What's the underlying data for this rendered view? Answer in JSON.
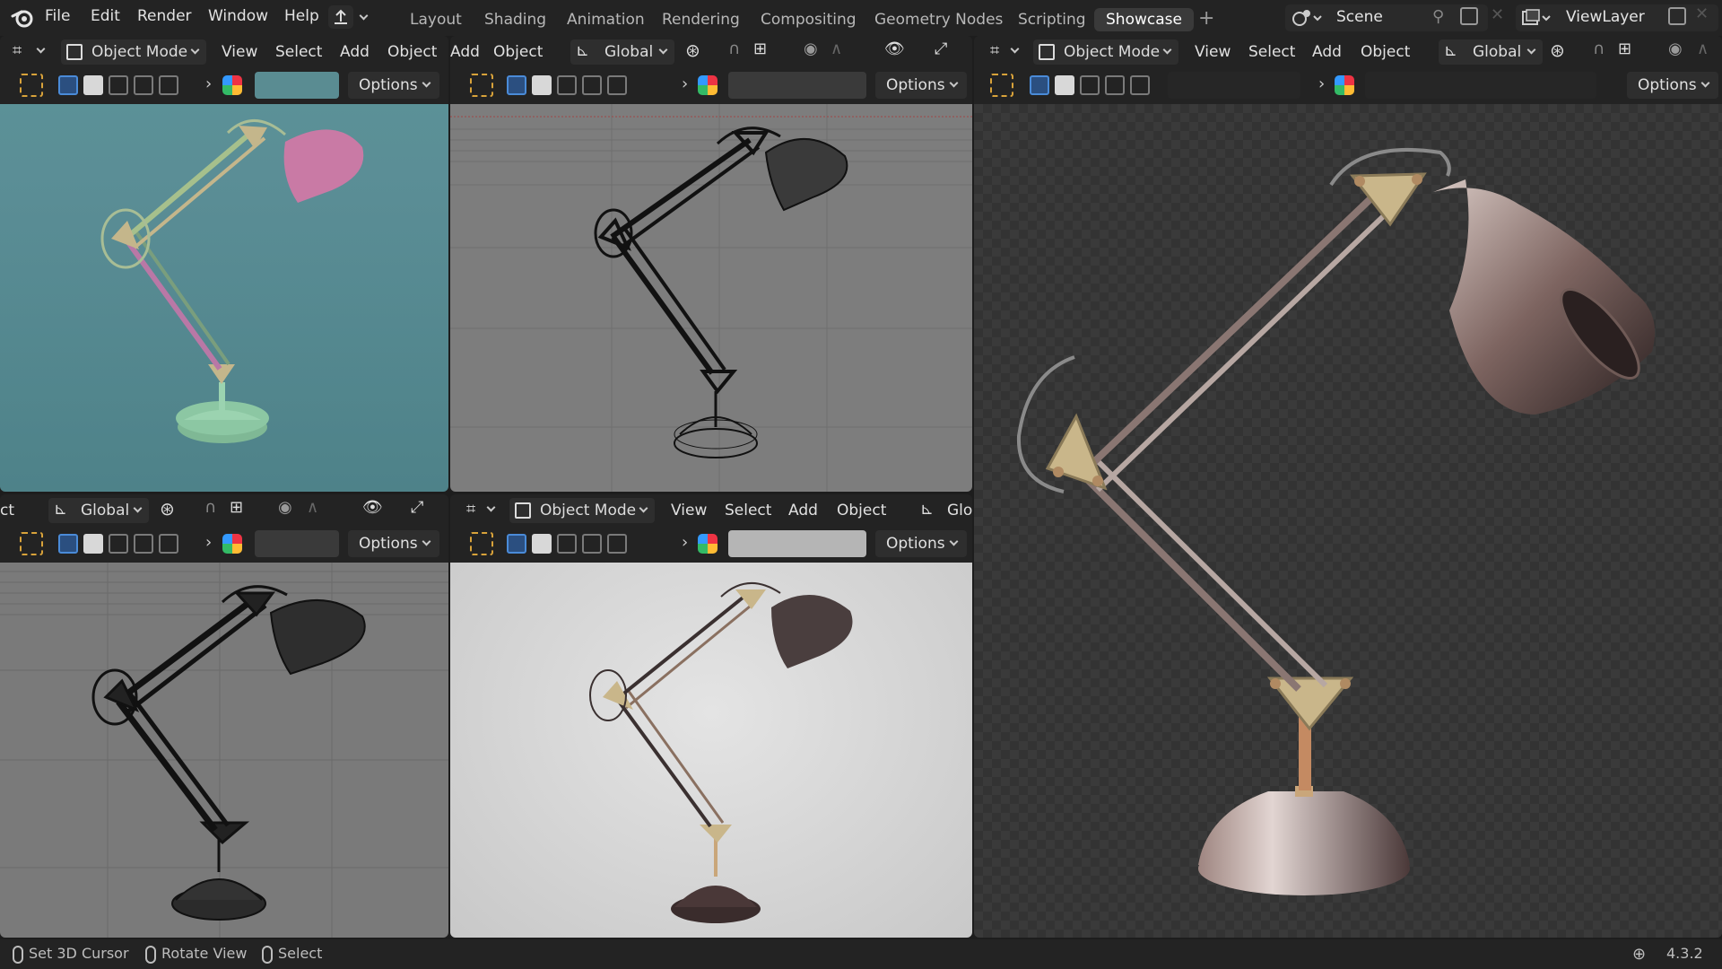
{
  "topbar": {
    "menus": [
      "File",
      "Edit",
      "Render",
      "Window",
      "Help"
    ],
    "workspaces": [
      "Layout",
      "Shading",
      "Animation",
      "Rendering",
      "Compositing",
      "Geometry Nodes",
      "Scripting",
      "Showcase"
    ],
    "active_workspace": "Showcase",
    "scene_label": "Scene",
    "view_layer_label": "ViewLayer"
  },
  "viewports": {
    "top_left": {
      "mode": "Object Mode",
      "menus": [
        "View",
        "Select",
        "Add",
        "Object"
      ],
      "options": "Options",
      "style": "material-solid"
    },
    "top_mid": {
      "menus": [
        "Add",
        "Object"
      ],
      "transform": "Global",
      "options": "Options",
      "style": "wireframe"
    },
    "bottom_left": {
      "menu_fragment": "ct",
      "transform": "Global",
      "options": "Options",
      "style": "solid-wire"
    },
    "bottom_mid": {
      "mode": "Object Mode",
      "menus": [
        "View",
        "Select",
        "Add",
        "Object"
      ],
      "transform_fragment": "Glo",
      "options": "Options",
      "style": "solid"
    },
    "right": {
      "mode": "Object Mode",
      "menus": [
        "View",
        "Select",
        "Add",
        "Object"
      ],
      "transform": "Global",
      "options": "Options",
      "style": "rendered"
    }
  },
  "statusbar": {
    "hints": [
      "Set 3D Cursor",
      "Rotate View",
      "Select"
    ],
    "version": "4.3.2"
  },
  "colors": {
    "accent": "#4a8bd8",
    "teal_bg": "#5b8f96",
    "pink_shade": "#c97aa5",
    "green_base": "#7fb895",
    "lamp_gold": "#c9b68a"
  }
}
